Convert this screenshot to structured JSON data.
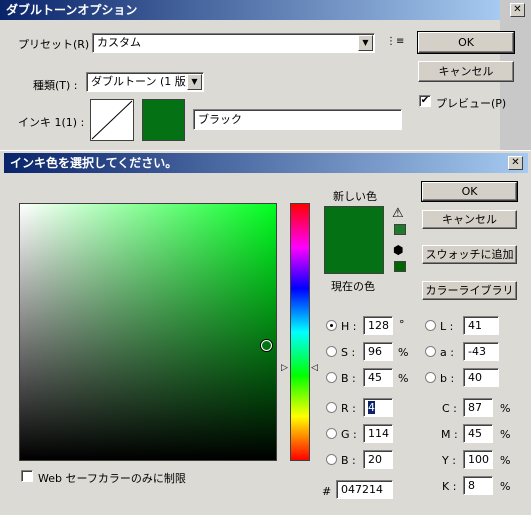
{
  "duotone": {
    "title": "ダブルトーンオプション",
    "preset_label": "プリセット(R) :",
    "preset_value": "カスタム",
    "type_label": "種類(T) :",
    "type_value": "ダブルトーン (1 版)",
    "ink1_label": "インキ 1(1) :",
    "ink1_name": "ブラック",
    "ok_label": "OK",
    "cancel_label": "キャンセル",
    "preview_label": "プレビュー(P)",
    "preview_checked": true
  },
  "picker": {
    "title": "インキ色を選択してください。",
    "new_label": "新しい色",
    "current_label": "現在の色",
    "ok_label": "OK",
    "cancel_label": "キャンセル",
    "add_swatch_label": "スウォッチに追加",
    "color_libraries_label": "カラーライブラリ",
    "web_only_label": "Web セーフカラーのみに制限",
    "hsb": {
      "h_label": "H :",
      "h_value": "128",
      "h_unit": "°",
      "s_label": "S :",
      "s_value": "96",
      "s_unit": "%",
      "b_label": "B :",
      "b_value": "45",
      "b_unit": "%"
    },
    "rgb": {
      "r_label": "R :",
      "r_value": "4",
      "g_label": "G :",
      "g_value": "114",
      "b_label": "B :",
      "b_value": "20"
    },
    "lab": {
      "l_label": "L :",
      "l_value": "41",
      "a_label": "a :",
      "a_value": "-43",
      "b_label": "b :",
      "b_value": "40"
    },
    "cmyk": {
      "c_label": "C :",
      "c_value": "87",
      "m_label": "M :",
      "m_value": "45",
      "y_label": "Y :",
      "y_value": "100",
      "k_label": "K :",
      "k_value": "8",
      "unit": "%"
    },
    "hex_label": "#",
    "hex_value": "047214"
  },
  "colors": {
    "selected": "#047214",
    "gamut_swatch": "#1f7a2d",
    "websafe_swatch": "#006600"
  }
}
